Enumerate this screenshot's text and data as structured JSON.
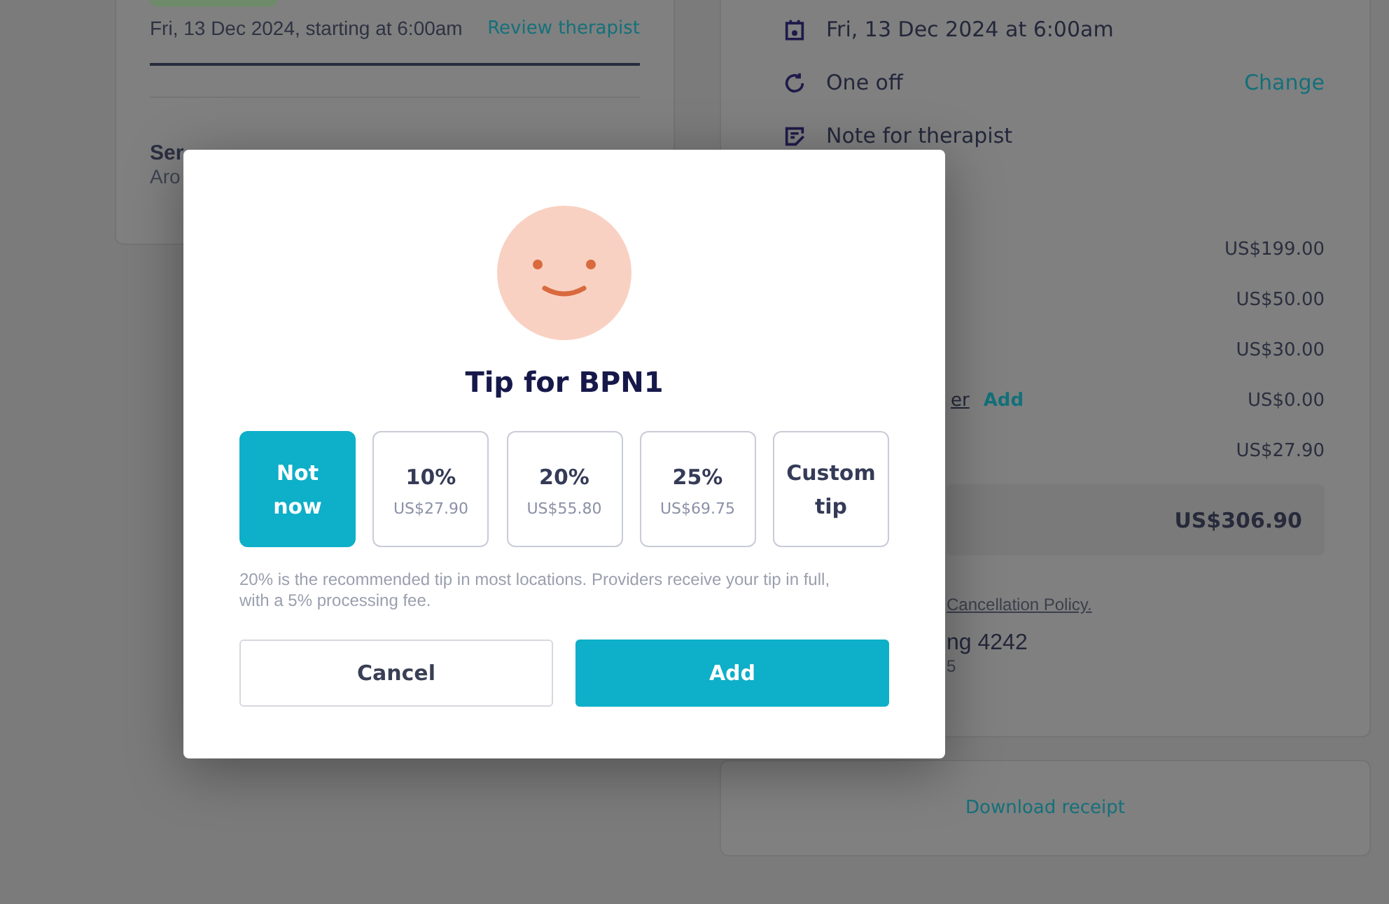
{
  "booking_card": {
    "date": "Fri, 13 Dec 2024, starting at 6:00am",
    "review_link": "Review therapist",
    "service_title": "Ser",
    "service_subtitle": "Aro"
  },
  "summary_card": {
    "details": [
      {
        "kind": "calendar",
        "text": "Fri, 13 Dec 2024 at 6:00am"
      },
      {
        "kind": "repeat",
        "text": "One off",
        "action": "Change"
      },
      {
        "kind": "note",
        "text": "Note for therapist"
      }
    ],
    "prices": [
      {
        "amount": "US$199.00"
      },
      {
        "amount": "US$50.00"
      },
      {
        "amount": "US$30.00"
      },
      {
        "label": "er",
        "action": "Add",
        "amount": "US$0.00"
      },
      {
        "amount": "US$27.90"
      }
    ],
    "total": "US$306.90",
    "policy_link": "Cancellation Policy.",
    "card_title": "ng 4242",
    "card_subtitle": "5"
  },
  "download_receipt": "Download receipt",
  "tip_dialog": {
    "title": "Tip for BPN1",
    "options": [
      {
        "label": "Not now",
        "selected": true
      },
      {
        "label": "10%",
        "amount": "US$27.90",
        "selected": false
      },
      {
        "label": "20%",
        "amount": "US$55.80",
        "selected": false
      },
      {
        "label": "25%",
        "amount": "US$69.75",
        "selected": false
      },
      {
        "label": "Custom tip",
        "selected": false
      }
    ],
    "note": "20% is the recommended tip in most locations. Providers receive your tip in full, with a 5% processing fee.",
    "buttons": [
      {
        "kind": "secondary",
        "label": "Cancel"
      },
      {
        "kind": "primary",
        "label": "Add"
      }
    ]
  }
}
